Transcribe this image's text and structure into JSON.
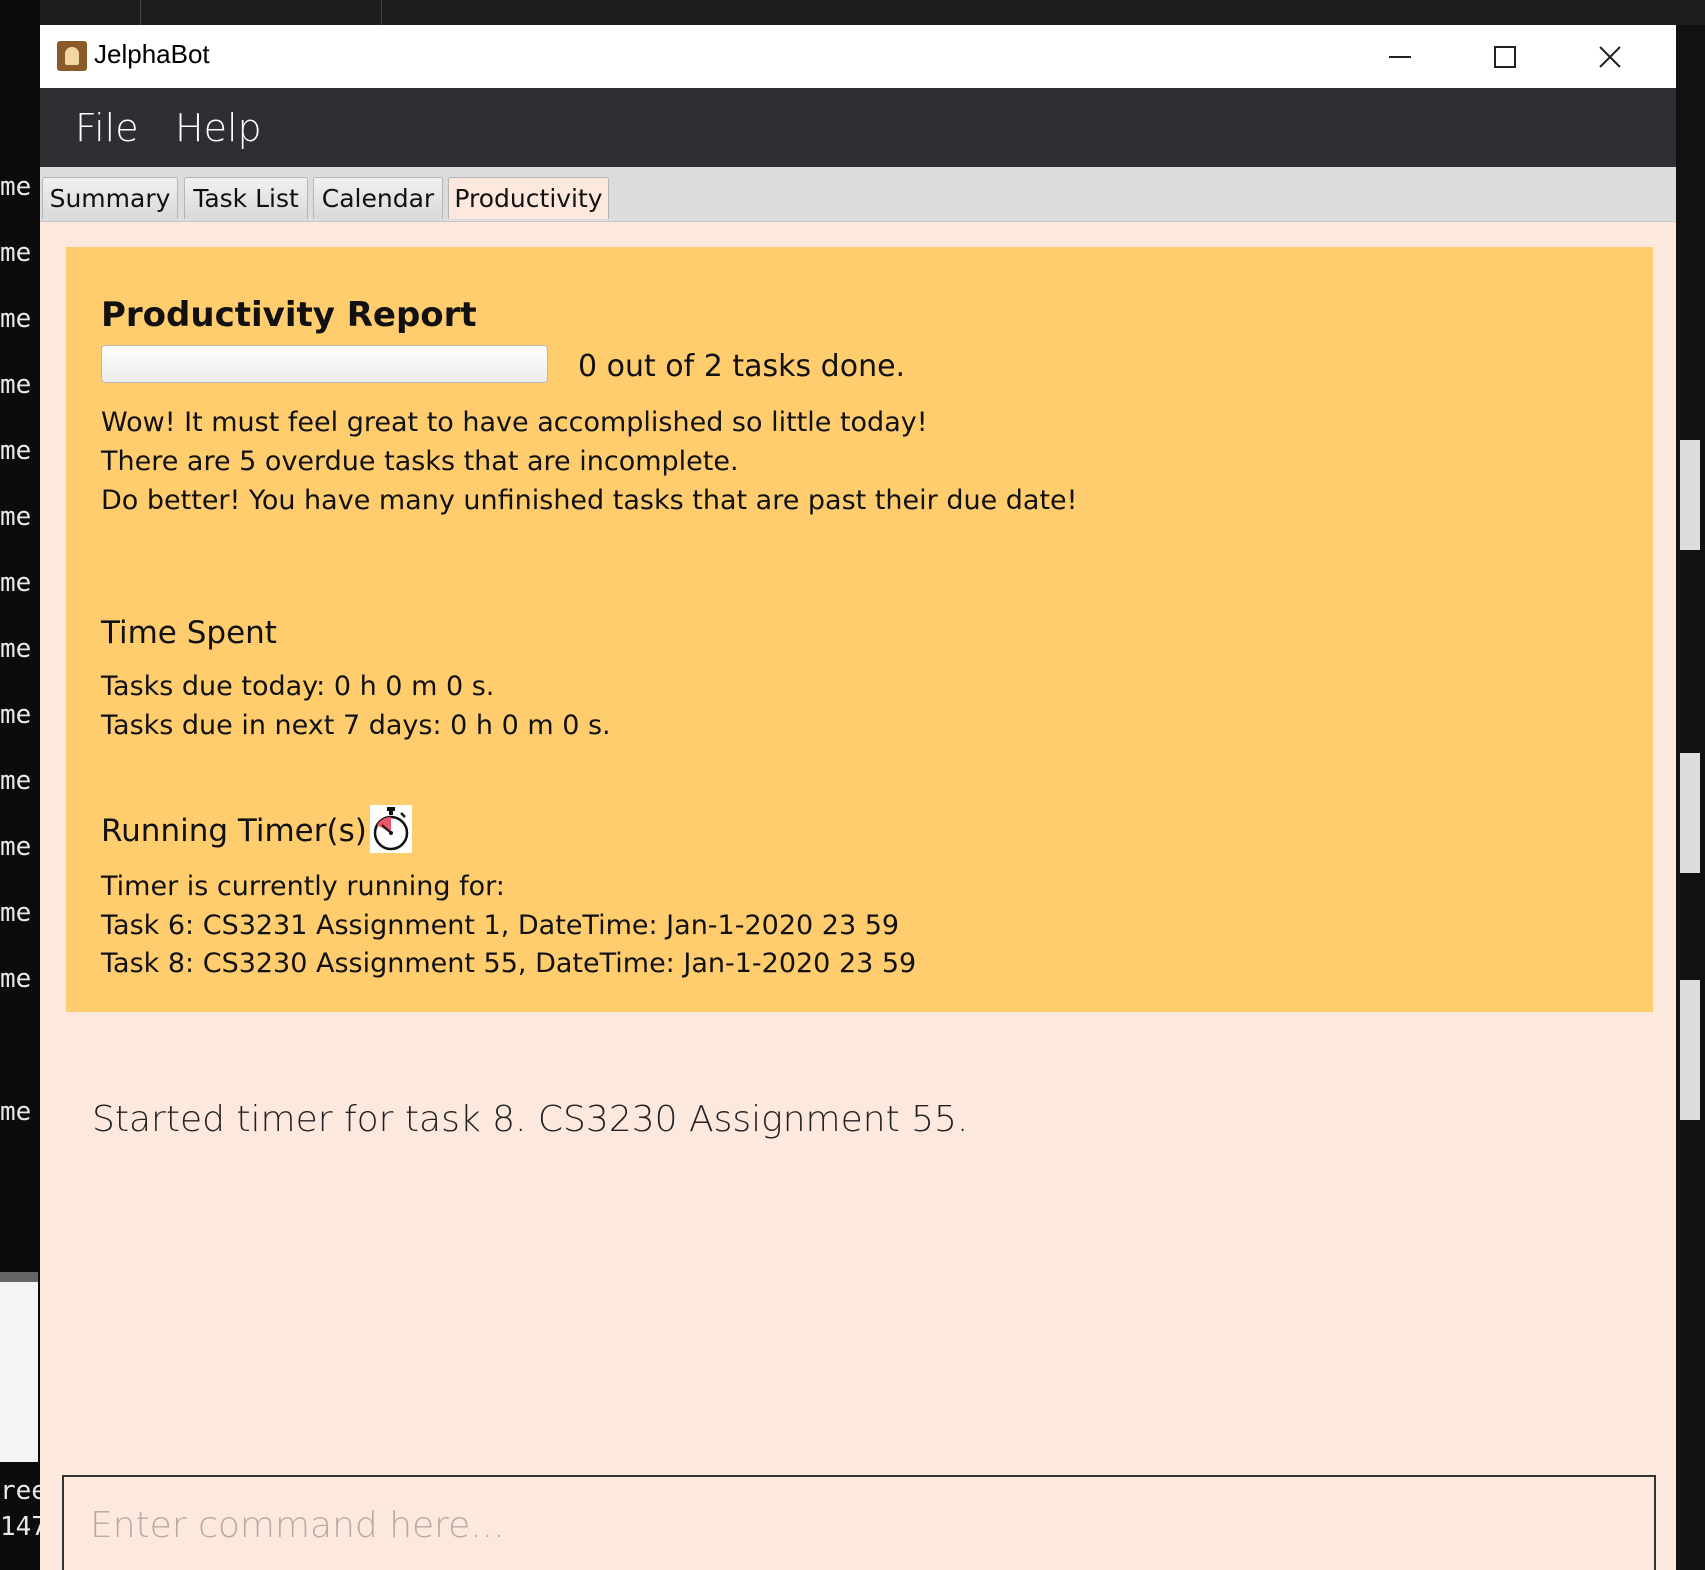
{
  "background": {
    "left_words": [
      "me",
      "me",
      "me",
      "me",
      "me",
      "me",
      "me",
      "me",
      "me",
      "me",
      "me",
      "me",
      "me",
      "me",
      "ree",
      "147"
    ]
  },
  "window": {
    "title": "JelphaBot",
    "minimize_icon": "minimize-icon",
    "maximize_icon": "maximize-icon",
    "close_icon": "close-icon"
  },
  "menu": {
    "file": "File",
    "help": "Help"
  },
  "tabs": [
    {
      "label": "Summary",
      "active": false
    },
    {
      "label": "Task List",
      "active": false
    },
    {
      "label": "Calendar",
      "active": false
    },
    {
      "label": "Productivity",
      "active": true
    }
  ],
  "report": {
    "title": "Productivity Report",
    "progress": 0,
    "progress_text": "0 out of 2 tasks done.",
    "messages": [
      "Wow! It must feel great to have accomplished so little today!",
      "There are 5 overdue tasks that are incomplete.",
      "Do better! You have many unfinished tasks that are past their due date!"
    ],
    "time_spent": {
      "title": "Time Spent",
      "today": "Tasks due today: 0 h 0 m 0 s.",
      "next7": "Tasks due in next 7 days: 0 h 0 m 0 s."
    },
    "running": {
      "title": "Running Timer(s)",
      "icon": "stopwatch-icon",
      "lines": [
        "Timer is currently running for:",
        "Task 6: CS3231 Assignment 1, DateTime: Jan-1-2020 23 59",
        "Task 8: CS3230 Assignment 55, DateTime: Jan-1-2020 23 59"
      ]
    }
  },
  "result": {
    "text": "Started timer for task 8. CS3230 Assignment 55."
  },
  "command": {
    "value": "",
    "placeholder": "Enter command here..."
  },
  "colors": {
    "menubar": "#2e2f33",
    "report_bg": "#ffcc6e",
    "window_bg": "#fde8de"
  }
}
